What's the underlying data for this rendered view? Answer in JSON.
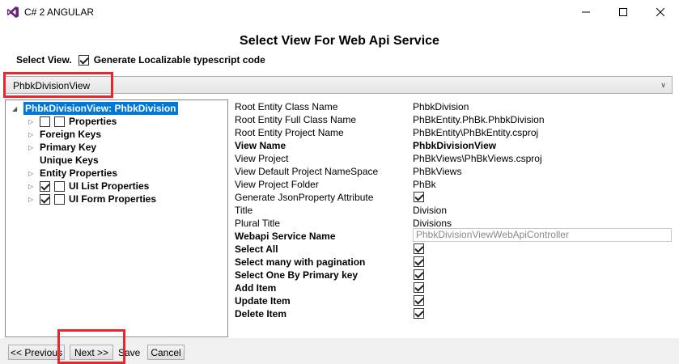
{
  "window": {
    "title": "C# 2 ANGULAR",
    "minimize_icon": "minimize-icon",
    "maximize_icon": "maximize-icon",
    "close_icon": "close-icon"
  },
  "heading": "Select View For Web Api Service",
  "select_view": {
    "label": "Select View.",
    "localizable_checked": true,
    "localizable_label": "Generate Localizable typescript code"
  },
  "combo": {
    "value": "PhbkDivisionView"
  },
  "tree": {
    "root": "PhbkDivisionView: PhbkDivision",
    "nodes": [
      {
        "label": "Properties",
        "expander": true,
        "checkboxes": [
          false,
          false
        ]
      },
      {
        "label": "Foreign Keys",
        "expander": true,
        "checkboxes": []
      },
      {
        "label": "Primary Key",
        "expander": true,
        "checkboxes": []
      },
      {
        "label": "Unique Keys",
        "expander": false,
        "checkboxes": []
      },
      {
        "label": "Entity Properties",
        "expander": true,
        "checkboxes": []
      },
      {
        "label": "UI List Properties",
        "expander": true,
        "checkboxes": [
          true,
          false
        ]
      },
      {
        "label": "UI Form Properties",
        "expander": true,
        "checkboxes": [
          true,
          false
        ]
      }
    ]
  },
  "properties": [
    {
      "label": "Root Entity Class Name",
      "value": "PhbkDivision",
      "bold": false,
      "kind": "text"
    },
    {
      "label": "Root Entity Full Class Name",
      "value": "PhBkEntity.PhBk.PhbkDivision",
      "bold": false,
      "kind": "text"
    },
    {
      "label": "Root Entity Project Name",
      "value": "PhBkEntity\\PhBkEntity.csproj",
      "bold": false,
      "kind": "text"
    },
    {
      "label": "View Name",
      "value": "PhbkDivisionView",
      "bold": true,
      "kind": "text"
    },
    {
      "label": "View Project",
      "value": "PhBkViews\\PhBkViews.csproj",
      "bold": false,
      "kind": "text"
    },
    {
      "label": "View Default Project NameSpace",
      "value": "PhBkViews",
      "bold": false,
      "kind": "text"
    },
    {
      "label": "View Project Folder",
      "value": "PhBk",
      "bold": false,
      "kind": "text"
    },
    {
      "label": "Generate JsonProperty Attribute",
      "checked": true,
      "bold": false,
      "kind": "check"
    },
    {
      "label": "Title",
      "value": "Division",
      "bold": false,
      "kind": "text"
    },
    {
      "label": "Plural Title",
      "value": "Divisions",
      "bold": false,
      "kind": "text"
    },
    {
      "label": "Webapi Service Name",
      "value": "PhbkDivisionViewWebApiController",
      "bold": true,
      "kind": "input"
    },
    {
      "label": "Select All",
      "checked": true,
      "bold": true,
      "kind": "check"
    },
    {
      "label": "Select many with pagination",
      "checked": true,
      "bold": true,
      "kind": "check"
    },
    {
      "label": "Select One By Primary key",
      "checked": true,
      "bold": true,
      "kind": "check"
    },
    {
      "label": "Add Item",
      "checked": true,
      "bold": true,
      "kind": "check"
    },
    {
      "label": "Update Item",
      "checked": true,
      "bold": true,
      "kind": "check"
    },
    {
      "label": "Delete Item",
      "checked": true,
      "bold": true,
      "kind": "check"
    }
  ],
  "footer": {
    "prev_label": "<< Previous",
    "next_label": "Next >>",
    "save_label": "Save",
    "cancel_label": "Cancel"
  },
  "colors": {
    "highlight": "#e8262d",
    "selection": "#0078d7",
    "vs_purple": "#68217a"
  }
}
